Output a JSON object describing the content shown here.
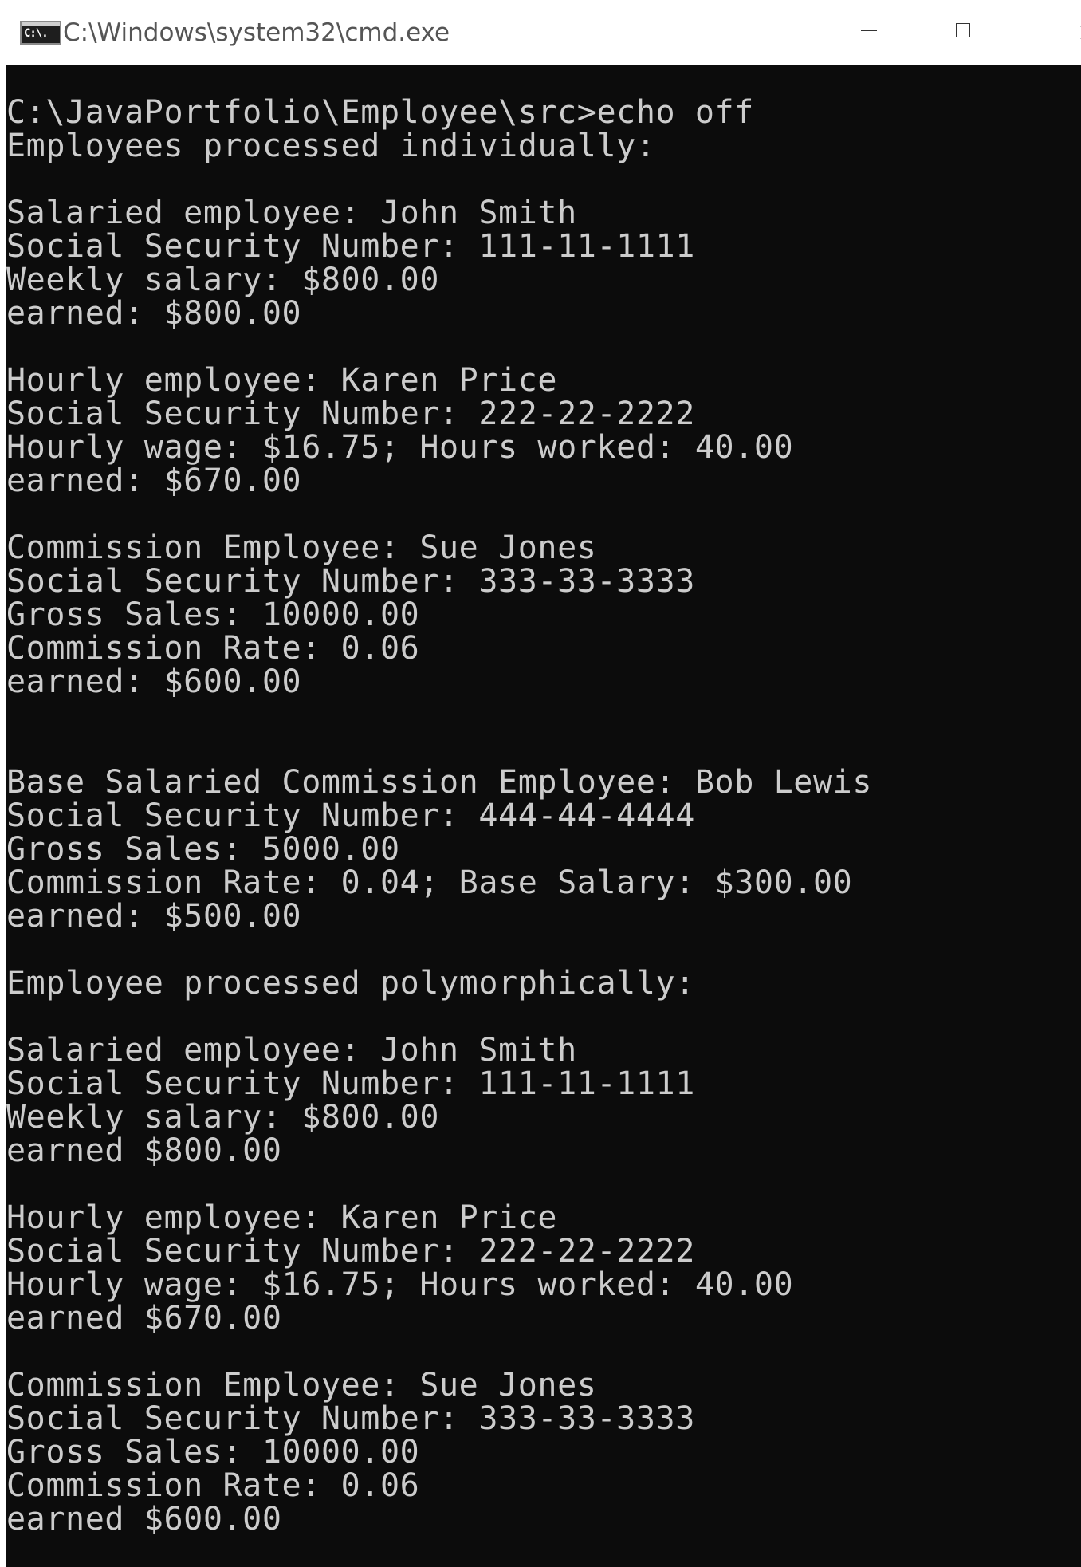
{
  "window": {
    "title": "C:\\Windows\\system32\\cmd.exe",
    "icon": "cmd-terminal-icon",
    "icon_text": "C:\\."
  },
  "controls": {
    "minimize": "minimize-icon",
    "maximize": "maximize-icon",
    "close": "close-icon"
  },
  "console": {
    "lines": [
      "C:\\JavaPortfolio\\Employee\\src>echo off",
      "Employees processed individually:",
      "",
      "Salaried employee: John Smith",
      "Social Security Number: 111-11-1111",
      "Weekly salary: $800.00",
      "earned: $800.00",
      "",
      "Hourly employee: Karen Price",
      "Social Security Number: 222-22-2222",
      "Hourly wage: $16.75; Hours worked: 40.00",
      "earned: $670.00",
      "",
      "Commission Employee: Sue Jones",
      "Social Security Number: 333-33-3333",
      "Gross Sales: 10000.00",
      "Commission Rate: 0.06",
      "earned: $600.00",
      "",
      "",
      "Base Salaried Commission Employee: Bob Lewis",
      "Social Security Number: 444-44-4444",
      "Gross Sales: 5000.00",
      "Commission Rate: 0.04; Base Salary: $300.00",
      "earned: $500.00",
      "",
      "Employee processed polymorphically:",
      "",
      "Salaried employee: John Smith",
      "Social Security Number: 111-11-1111",
      "Weekly salary: $800.00",
      "earned $800.00",
      "",
      "Hourly employee: Karen Price",
      "Social Security Number: 222-22-2222",
      "Hourly wage: $16.75; Hours worked: 40.00",
      "earned $670.00",
      "",
      "Commission Employee: Sue Jones",
      "Social Security Number: 333-33-3333",
      "Gross Sales: 10000.00",
      "Commission Rate: 0.06",
      "earned $600.00"
    ]
  },
  "colors": {
    "console_background": "#0c0c0c",
    "console_text": "#cccccc",
    "titlebar_background": "#ffffff",
    "title_text": "#555555"
  }
}
